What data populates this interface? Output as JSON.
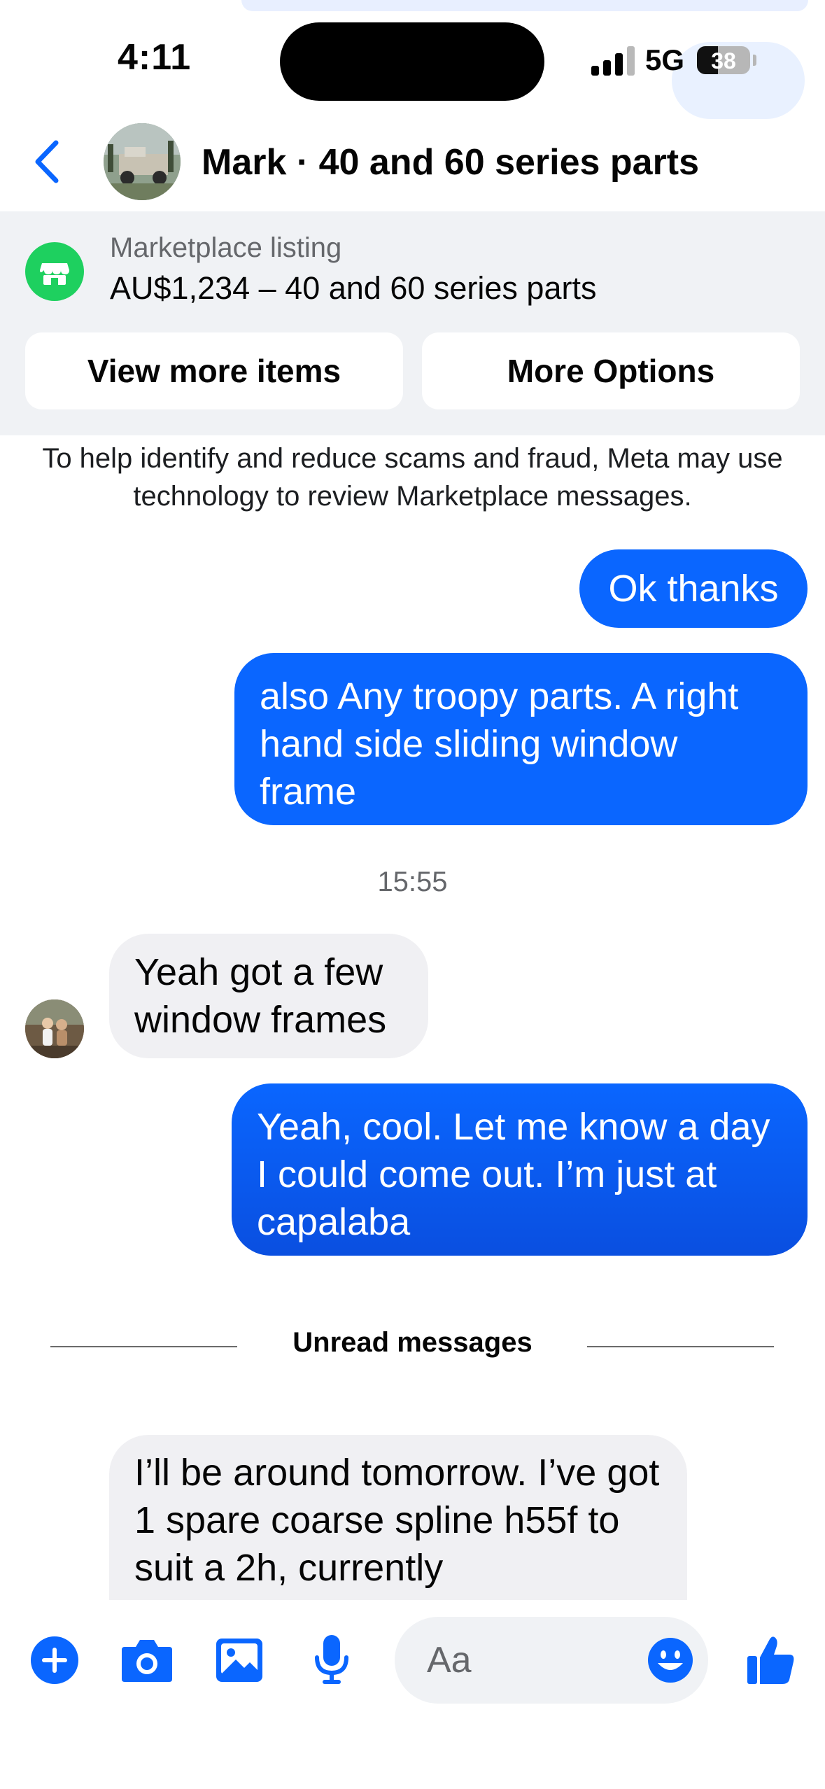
{
  "status_bar": {
    "time": "4:11",
    "network": "5G",
    "battery": "38"
  },
  "header": {
    "title": "Mark · 40 and 60 series parts"
  },
  "listing": {
    "label": "Marketplace listing",
    "price_title": "AU$1,234 – 40 and 60 series parts",
    "view_more_label": "View more items",
    "more_options_label": "More Options"
  },
  "notice": "To help identify and reduce scams and fraud, Meta may use technology to review Marketplace messages.",
  "messages": [
    {
      "direction": "out",
      "text": "Ok thanks"
    },
    {
      "direction": "out",
      "text": "also Any troopy parts. A right hand side sliding window frame"
    },
    {
      "direction": "in",
      "text": "Yeah got a few window frames"
    },
    {
      "direction": "out",
      "text": "Yeah, cool. Let me know a day I could come out. I’m just at capalaba"
    },
    {
      "direction": "in",
      "text": "I’ll be around tomorrow. I’ve got 1 spare coarse spline h55f to suit a 2h, currently"
    }
  ],
  "timestamp": "15:55",
  "unread_label": "Unread messages",
  "composer": {
    "placeholder": "Aa"
  },
  "colors": {
    "accent": "#0a66ff",
    "marketplace_green": "#1ed05f",
    "panel_bg": "#f0f2f5"
  },
  "icons": [
    "chevron-left-icon",
    "marketplace-store-icon",
    "plus-icon",
    "camera-icon",
    "photo-icon",
    "microphone-icon",
    "emoji-icon",
    "thumbs-up-icon"
  ]
}
